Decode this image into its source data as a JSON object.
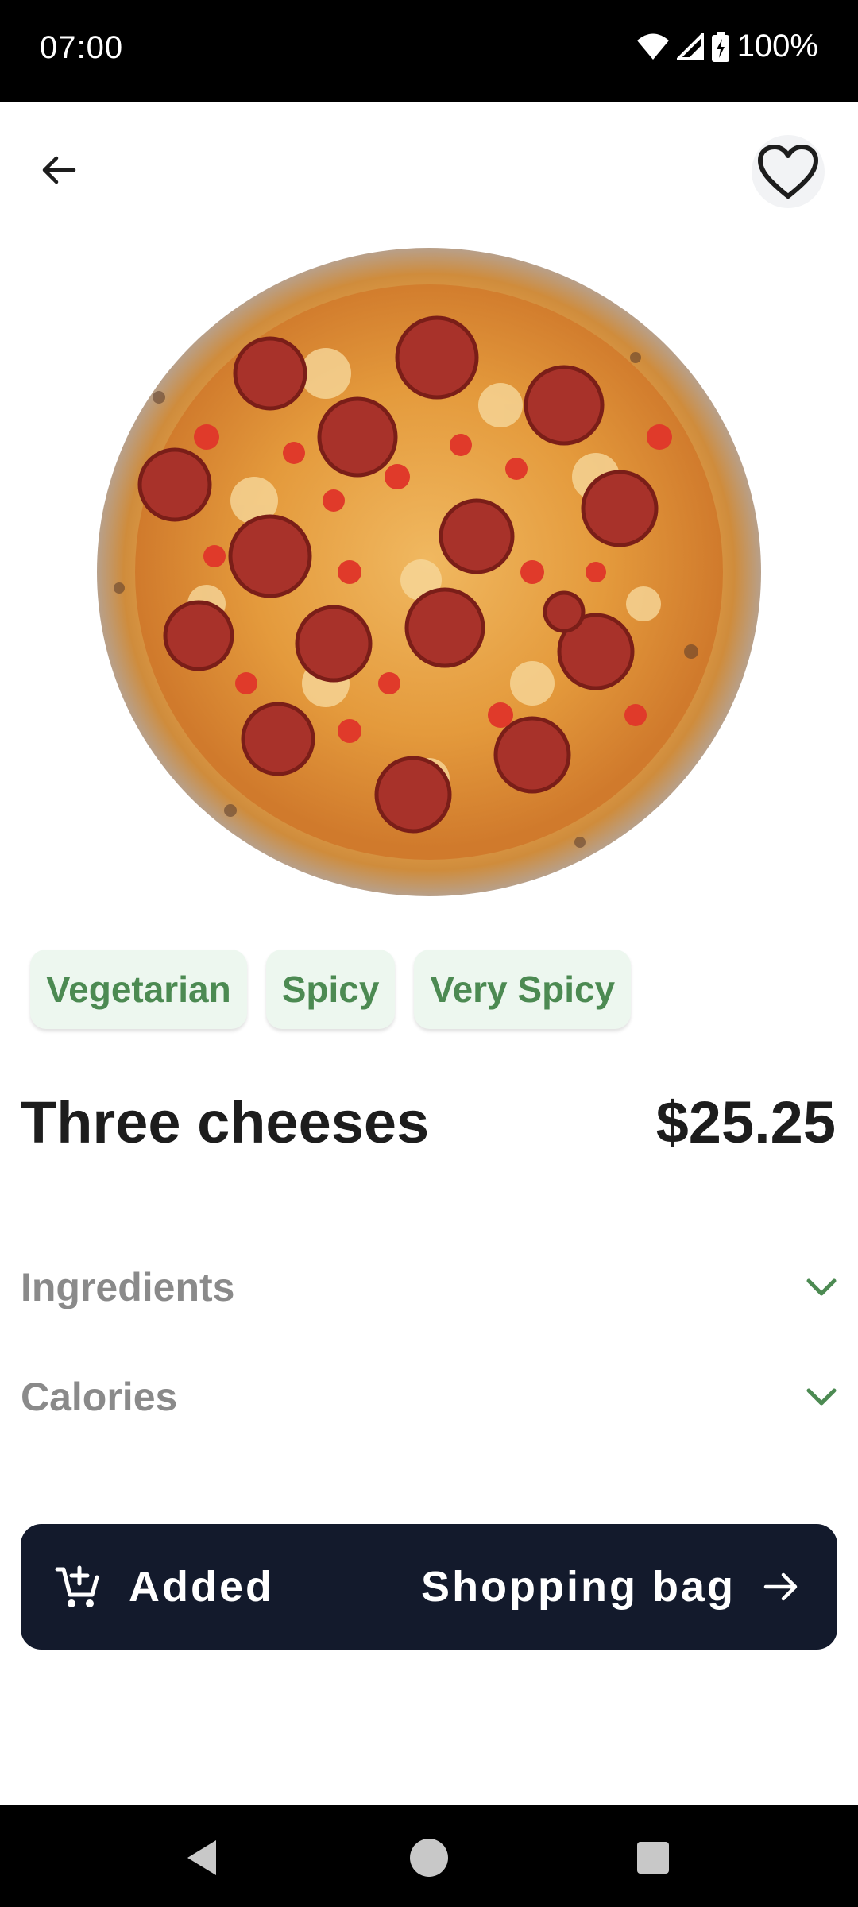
{
  "status_bar": {
    "time": "07:00",
    "battery": "100%"
  },
  "product": {
    "tags": [
      "Vegetarian",
      "Spicy",
      "Very Spicy"
    ],
    "name": "Three cheeses",
    "price": "$25.25"
  },
  "sections": {
    "ingredients": "Ingredients",
    "calories": "Calories"
  },
  "action": {
    "added_label": "Added",
    "bag_label": "Shopping bag"
  },
  "icons": {
    "back": "arrow-left-icon",
    "favorite": "heart-outline-icon",
    "expand": "chevron-down-icon",
    "cart": "add-to-cart-icon",
    "forward": "arrow-right-icon"
  },
  "colors": {
    "tag_bg": "#edf7ef",
    "tag_text": "#4c8a52",
    "button_bg": "#131a2c",
    "chevron": "#4c8a52"
  }
}
